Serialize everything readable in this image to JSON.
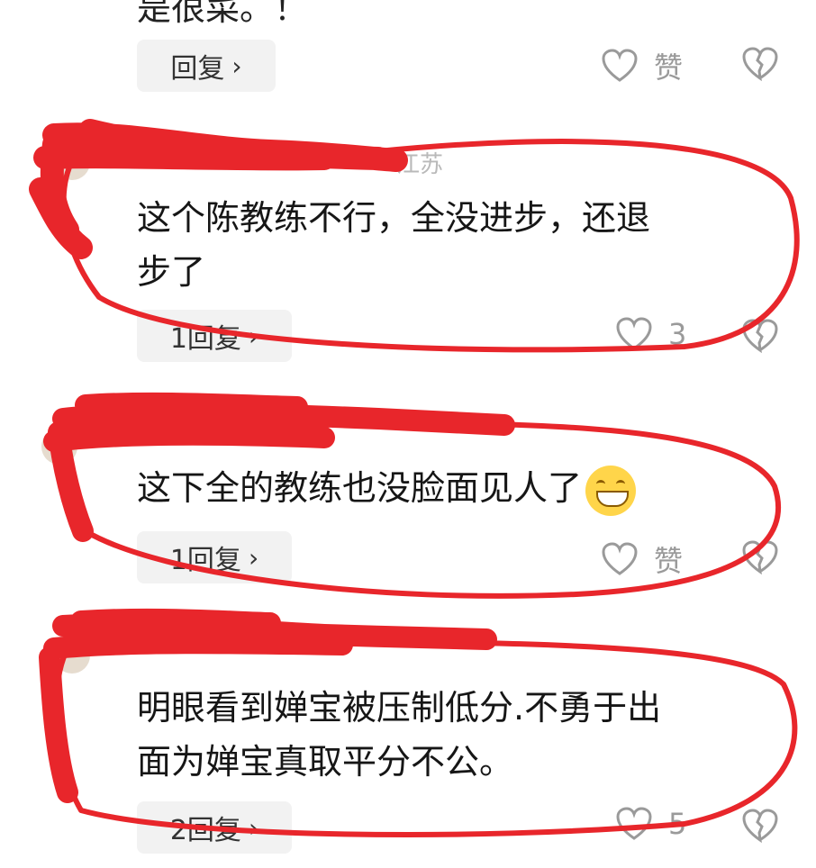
{
  "top_partial": {
    "text": "是很菜。！",
    "reply_label": "回复",
    "like_label": "赞"
  },
  "comments": [
    {
      "meta": "江苏",
      "text_line1": "这个陈教练不行，全没进步，还退",
      "text_line2": "步了",
      "reply_label": "1回复",
      "like_count": "3"
    },
    {
      "meta": "",
      "text": "这下全的教练也没脸面见人了",
      "reply_label": "1回复",
      "like_label": "赞"
    },
    {
      "meta": "",
      "text_line1": "明眼看到婵宝被压制低分.不勇于出",
      "text_line2": "面为婵宝真取平分不公。",
      "reply_label": "2回复",
      "like_count": "5"
    }
  ],
  "icons": {
    "like": "heart-icon",
    "dislike": "broken-heart-icon",
    "reply_chevron": "chevron-right-icon",
    "emoji": "grinning-emoji-icon"
  },
  "colors": {
    "scribble": "#e8262b",
    "reply_bg": "#f2f2f2",
    "meta_gray": "#b9b9b9"
  }
}
